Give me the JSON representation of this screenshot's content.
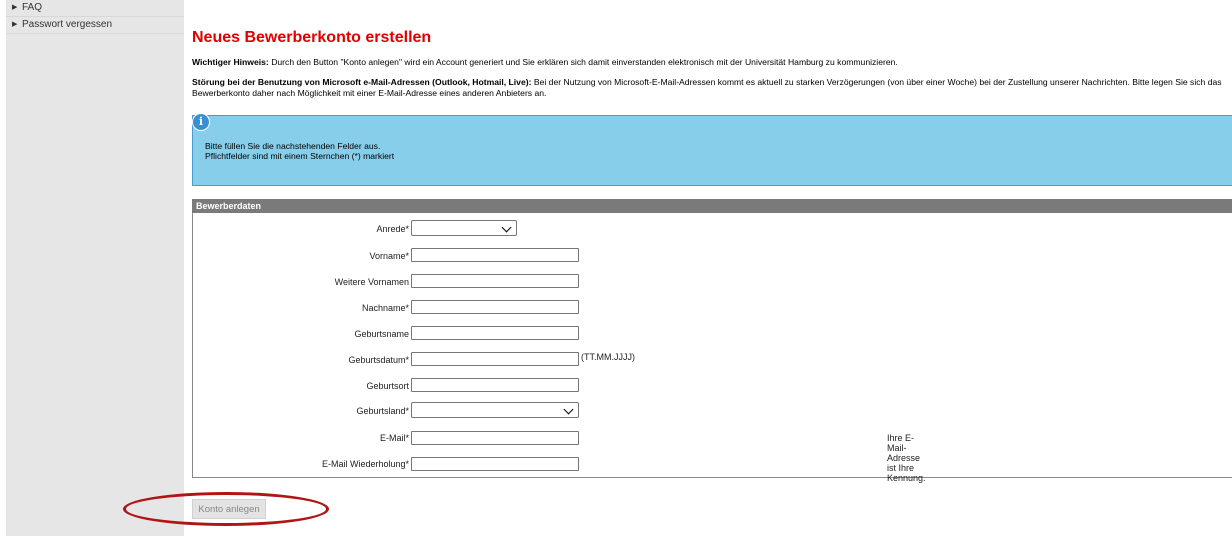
{
  "sidebar": {
    "items": [
      {
        "label": "FAQ"
      },
      {
        "label": "Passwort vergessen"
      }
    ]
  },
  "title": "Neues Bewerberkonto erstellen",
  "hint": {
    "label": "Wichtiger Hinweis:",
    "text": " Durch den Button \"Konto anlegen\" wird ein Account generiert und Sie erklären sich damit einverstanden elektronisch mit der Universität Hamburg zu kommunizieren."
  },
  "warning": {
    "label": "Störung bei der Benutzung von Microsoft e-Mail-Adressen (Outlook, Hotmail, Live):",
    "text": " Bei der Nutzung von Microsoft-E-Mail-Adressen kommt es aktuell zu starken Verzögerungen (von über einer Woche) bei der Zustellung unserer Nachrichten. Bitte legen Sie sich das Bewerberkonto daher nach Möglichkeit mit einer E-Mail-Adresse eines anderen Anbieters an."
  },
  "info": {
    "icon": "info-icon",
    "line1": "Bitte füllen Sie die nachstehenden Felder aus.",
    "line2": "Pflichtfelder sind mit einem Sternchen (*) markiert"
  },
  "form": {
    "header": "Bewerberdaten",
    "fields": {
      "anrede": "Anrede*",
      "vorname": "Vorname*",
      "weitere": "Weitere Vornamen",
      "nachname": "Nachname*",
      "geburtsname": "Geburtsname",
      "geburtsdatum": "Geburtsdatum*",
      "geburtsort": "Geburtsort",
      "geburtsland": "Geburtsland*",
      "email": "E-Mail*",
      "email2": "E-Mail Wiederholung*"
    },
    "date_format": "(TT.MM.JJJJ)",
    "email_note": "Ihre E-Mail-Adresse ist Ihre Kennung."
  },
  "submit_label": "Konto anlegen",
  "colors": {
    "title": "#e10000",
    "info_bg": "#87ceeb",
    "header_bg": "#7a7a7a",
    "highlight": "#b01515"
  }
}
